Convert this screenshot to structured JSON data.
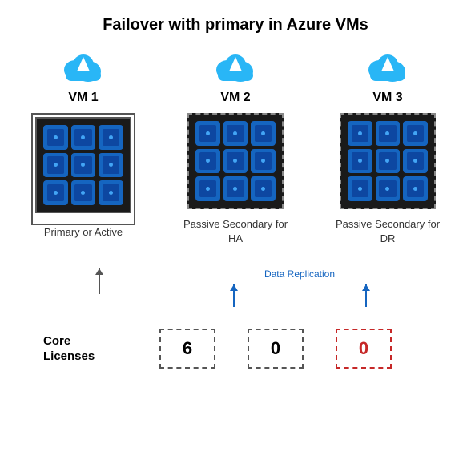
{
  "title": "Failover with primary in Azure VMs",
  "vms": [
    {
      "id": "vm1",
      "label": "VM 1",
      "border_style": "solid",
      "outer_border": true,
      "description": "Primary or Active",
      "chips": 9
    },
    {
      "id": "vm2",
      "label": "VM 2",
      "border_style": "dashed",
      "outer_border": false,
      "description": "Passive Secondary for HA",
      "chips": 9
    },
    {
      "id": "vm3",
      "label": "VM 3",
      "border_style": "dashed",
      "outer_border": false,
      "description": "Passive Secondary for DR",
      "chips": 9
    }
  ],
  "data_replication_label": "Data Replication",
  "licenses": {
    "label": "Core\nLicenses",
    "boxes": [
      {
        "value": "6",
        "red": false
      },
      {
        "value": "0",
        "red": false
      },
      {
        "value": "0",
        "red": true
      }
    ]
  }
}
